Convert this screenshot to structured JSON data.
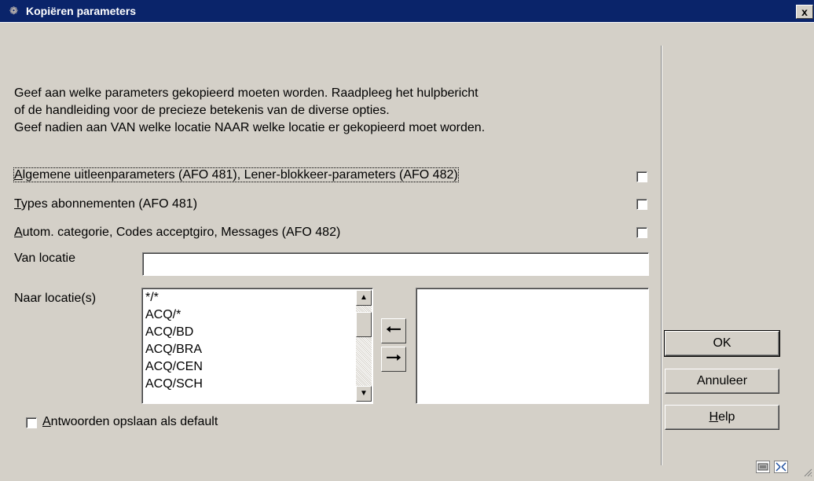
{
  "window": {
    "title": "Kopiëren parameters",
    "title_icon": "app-icon",
    "close_label": "x"
  },
  "intro": {
    "line1": "Geef aan welke parameters gekopieerd moeten worden. Raadpleeg het hulpbericht",
    "line2": "of de handleiding voor de precieze betekenis van de diverse opties.",
    "line3": "Geef nadien aan VAN welke locatie NAAR welke locatie er gekopieerd moet worden."
  },
  "options": [
    {
      "accel": "A",
      "rest": "lgemene uitleenparameters (AFO 481), Lener-blokkeer-parameters (AFO 482)",
      "checked": false
    },
    {
      "accel": "T",
      "rest": "ypes abonnementen (AFO 481)",
      "checked": false
    },
    {
      "accel": "A",
      "rest": "utom. categorie, Codes acceptgiro, Messages (AFO 482)",
      "checked": false
    }
  ],
  "van_locatie": {
    "label": "Van locatie",
    "value": ""
  },
  "naar_locatie": {
    "label": "Naar locatie(s)",
    "items": [
      "*/*",
      "ACQ/*",
      "ACQ/BD",
      "ACQ/BRA",
      "ACQ/CEN",
      "ACQ/SCH"
    ],
    "selected_items": []
  },
  "save_default": {
    "accel": "A",
    "rest": "ntwoorden opslaan als default",
    "checked": false
  },
  "buttons": {
    "ok": "OK",
    "annuleer": "Annuleer",
    "help_accel": "H",
    "help_rest": "elp"
  },
  "icons": {
    "add": "arrow-left-icon",
    "remove": "arrow-right-icon"
  }
}
